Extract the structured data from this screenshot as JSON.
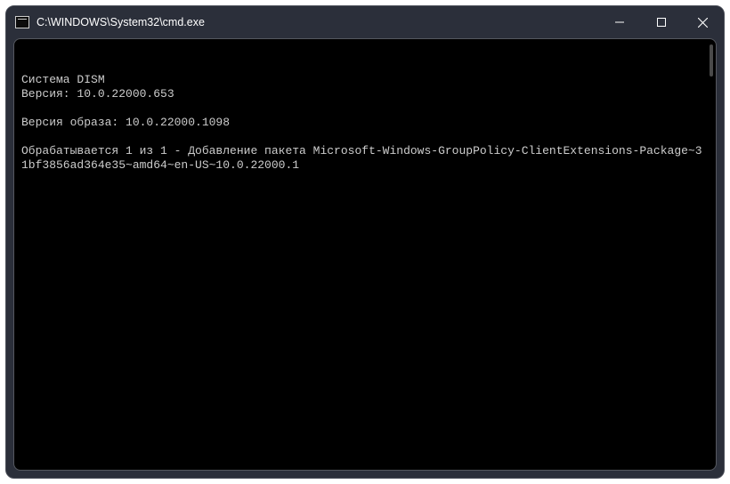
{
  "window": {
    "title": "C:\\WINDOWS\\System32\\cmd.exe"
  },
  "terminal": {
    "line1": "Cистема DISM",
    "line2": "Версия: 10.0.22000.653",
    "line3": "Версия образа: 10.0.22000.1098",
    "line4": "Обрабатывается 1 из 1 - Добавление пакета Microsoft-Windows-GroupPolicy-ClientExtensions-Package~31bf3856ad364e35~amd64~en-US~10.0.22000.1"
  }
}
